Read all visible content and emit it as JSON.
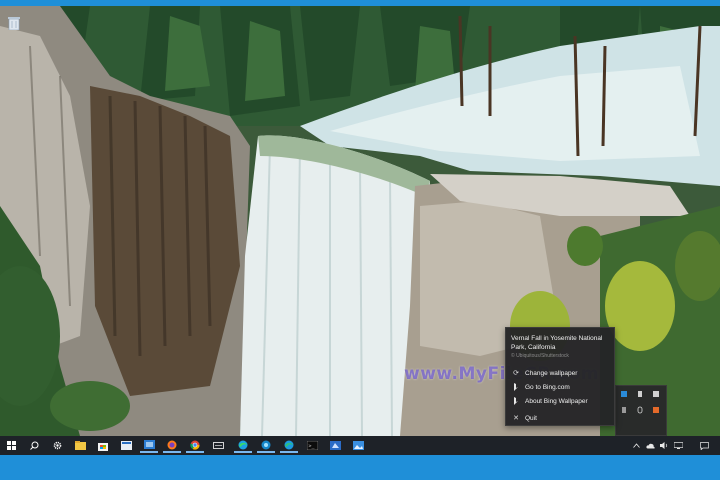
{
  "wallpaper": {
    "title": "Vernal Fall in Yosemite National Park, California",
    "subtitle": "© Ubiquitous/Shutterstock"
  },
  "watermark": "www.MyFileCR.com",
  "context_menu": {
    "items": [
      {
        "label": "Change wallpaper",
        "icon": "refresh-icon"
      },
      {
        "label": "Go to Bing.com",
        "icon": "bing-logo-icon"
      },
      {
        "label": "About Bing Wallpaper",
        "icon": "bing-logo-icon"
      },
      {
        "label": "Quit",
        "icon": "close-icon"
      }
    ]
  },
  "desktop_icons": [
    {
      "name": "recycle-bin-icon"
    }
  ],
  "taskbar": {
    "pinned": [
      {
        "name": "file-explorer-icon"
      },
      {
        "name": "microsoft-store-icon"
      },
      {
        "name": "terminal-icon"
      },
      {
        "name": "settings-window-icon"
      },
      {
        "name": "mail-icon"
      },
      {
        "name": "firefox-icon"
      },
      {
        "name": "chrome-icon"
      },
      {
        "name": "task-view-icon"
      },
      {
        "name": "edge-icon"
      },
      {
        "name": "edge-beta-icon"
      },
      {
        "name": "edge-dev-icon"
      },
      {
        "name": "command-prompt-icon"
      },
      {
        "name": "remote-app-icon"
      },
      {
        "name": "photos-app-icon"
      }
    ],
    "tray": [
      {
        "name": "chevron-up-icon"
      },
      {
        "name": "cloud-icon"
      },
      {
        "name": "speaker-icon"
      },
      {
        "name": "network-icon"
      },
      {
        "name": "notifications-icon"
      }
    ]
  },
  "colors": {
    "accent": "#1f8fd8",
    "taskbar_bg": "#1e2228",
    "menu_bg": "#242426",
    "bing_blue": "#2a8bd8"
  }
}
